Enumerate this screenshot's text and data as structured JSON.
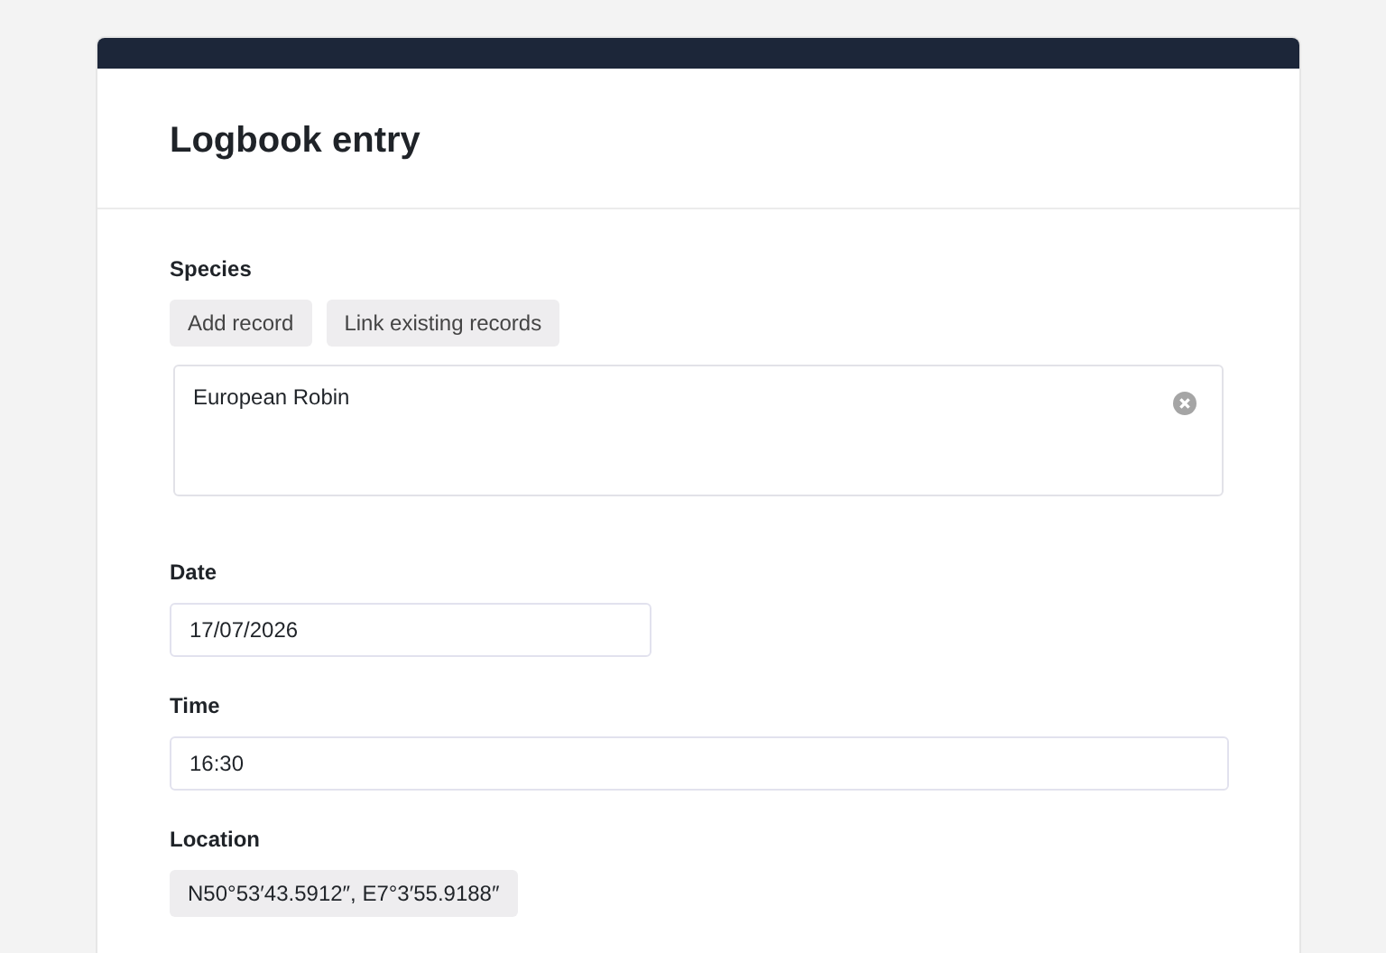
{
  "title": "Logbook entry",
  "species": {
    "label": "Species",
    "actions": [
      "Add record",
      "Link existing records"
    ],
    "records": [
      {
        "name": "European Robin"
      }
    ]
  },
  "date": {
    "label": "Date",
    "value": "17/07/2026"
  },
  "time": {
    "label": "Time",
    "value": "16:30"
  },
  "location": {
    "label": "Location",
    "value": "N50°53′43.5912″, E7°3′55.9188″"
  }
}
